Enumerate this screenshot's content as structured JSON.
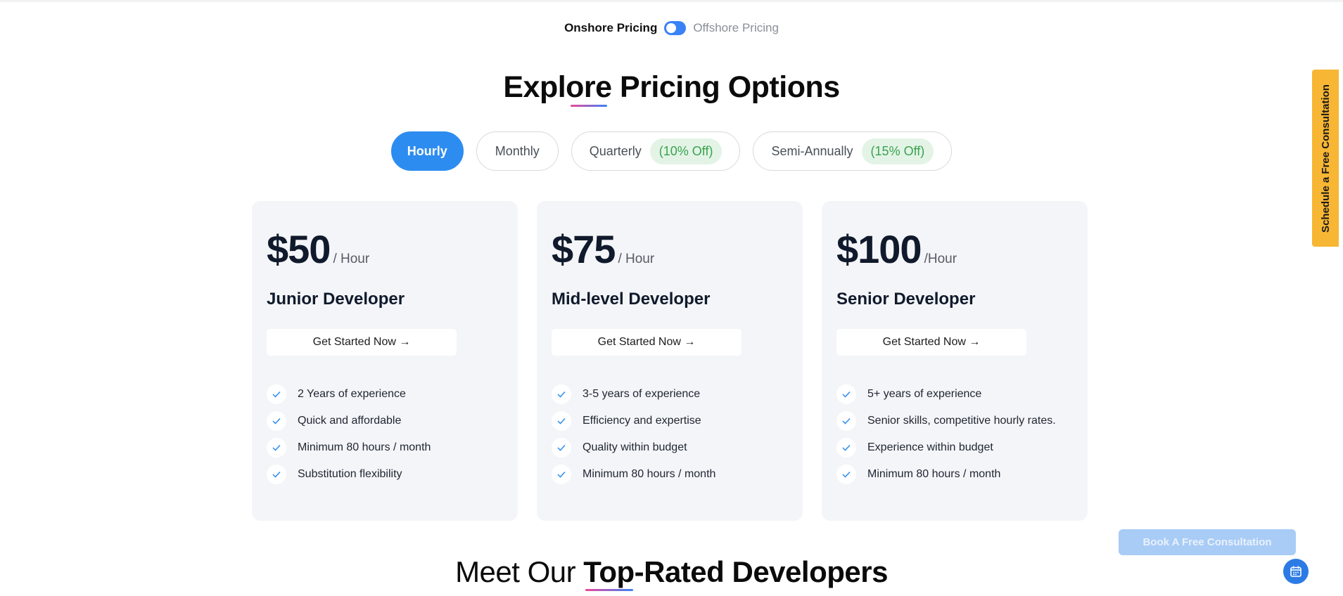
{
  "toggle": {
    "onshore_label": "Onshore Pricing",
    "offshore_label": "Offshore Pricing"
  },
  "heading": {
    "title": "Explore Pricing Options"
  },
  "tabs": [
    {
      "label": "Hourly",
      "discount": ""
    },
    {
      "label": "Monthly",
      "discount": ""
    },
    {
      "label": "Quarterly",
      "discount": "(10% Off)"
    },
    {
      "label": "Semi-Annually",
      "discount": "(15% Off)"
    }
  ],
  "plans": [
    {
      "price": "$50",
      "unit": "/ Hour",
      "role": "Junior Developer",
      "cta": "Get Started Now →",
      "features": [
        "2 Years of experience",
        "Quick and affordable",
        "Minimum 80 hours / month",
        "Substitution flexibility"
      ]
    },
    {
      "price": "$75",
      "unit": "/ Hour",
      "role": "Mid-level Developer",
      "cta": "Get Started Now →",
      "features": [
        "3-5 years of experience",
        "Efficiency and expertise",
        "Quality within budget",
        "Minimum 80 hours / month"
      ]
    },
    {
      "price": "$100",
      "unit": "/Hour",
      "role": "Senior Developer",
      "cta": "Get Started Now →",
      "features": [
        "5+ years of experience",
        "Senior skills, competitive hourly rates.",
        "Experience within budget",
        "Minimum 80 hours / month"
      ]
    }
  ],
  "side_tab": {
    "label": "Schedule a Free Consultation"
  },
  "book_button": {
    "label": "Book A Free Consultation"
  },
  "bottom_heading": {
    "part1": "Meet Our ",
    "part2": "Top-Rated Developers"
  },
  "colors": {
    "accent": "#2d8cf0",
    "side_tab": "#f7b634",
    "discount_text": "#3aa24f",
    "check": "#2d8cf0"
  },
  "icons": {
    "check": "check-icon",
    "calendar": "calendar-icon"
  }
}
